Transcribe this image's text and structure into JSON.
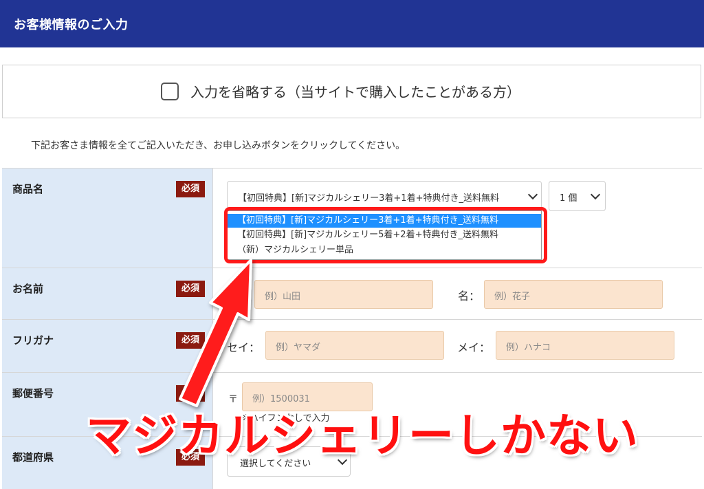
{
  "header": {
    "title": "お客様情報のご入力"
  },
  "skip": {
    "label": "入力を省略する（当サイトで購入したことがある方）",
    "checked": false
  },
  "instruction": "下記お客さま情報を全てご記入いただき、お申し込みボタンをクリックしてください。",
  "required_badge": "必須",
  "rows": {
    "product": {
      "label": "商品名",
      "select_value": "【初回特典】[新]マジカルシェリー3着+1着+特典付き_送料無料",
      "qty_value": "1 個",
      "options": [
        "【初回特典】[新]マジカルシェリー3着+1着+特典付き_送料無料",
        "【初回特典】[新]マジカルシェリー5着+2着+特典付き_送料無料",
        "（新）マジカルシェリー単品"
      ]
    },
    "name": {
      "label": "お名前",
      "first_placeholder": "例）山田",
      "given_label": "名：",
      "given_placeholder": "例）花子"
    },
    "furigana": {
      "label": "フリガナ",
      "sei_label": "セイ：",
      "sei_placeholder": "例）ヤマダ",
      "mei_label": "メイ：",
      "mei_placeholder": "例）ハナコ"
    },
    "postal": {
      "label": "郵便番号",
      "mark": "〒",
      "placeholder": "例）1500031",
      "note": "※ハイフンなしで入力"
    },
    "prefecture": {
      "label": "都道府県",
      "select_value": "選択してください"
    }
  },
  "annotation": {
    "text": "マジカルシェリーしかない",
    "color": "#ff1010"
  }
}
